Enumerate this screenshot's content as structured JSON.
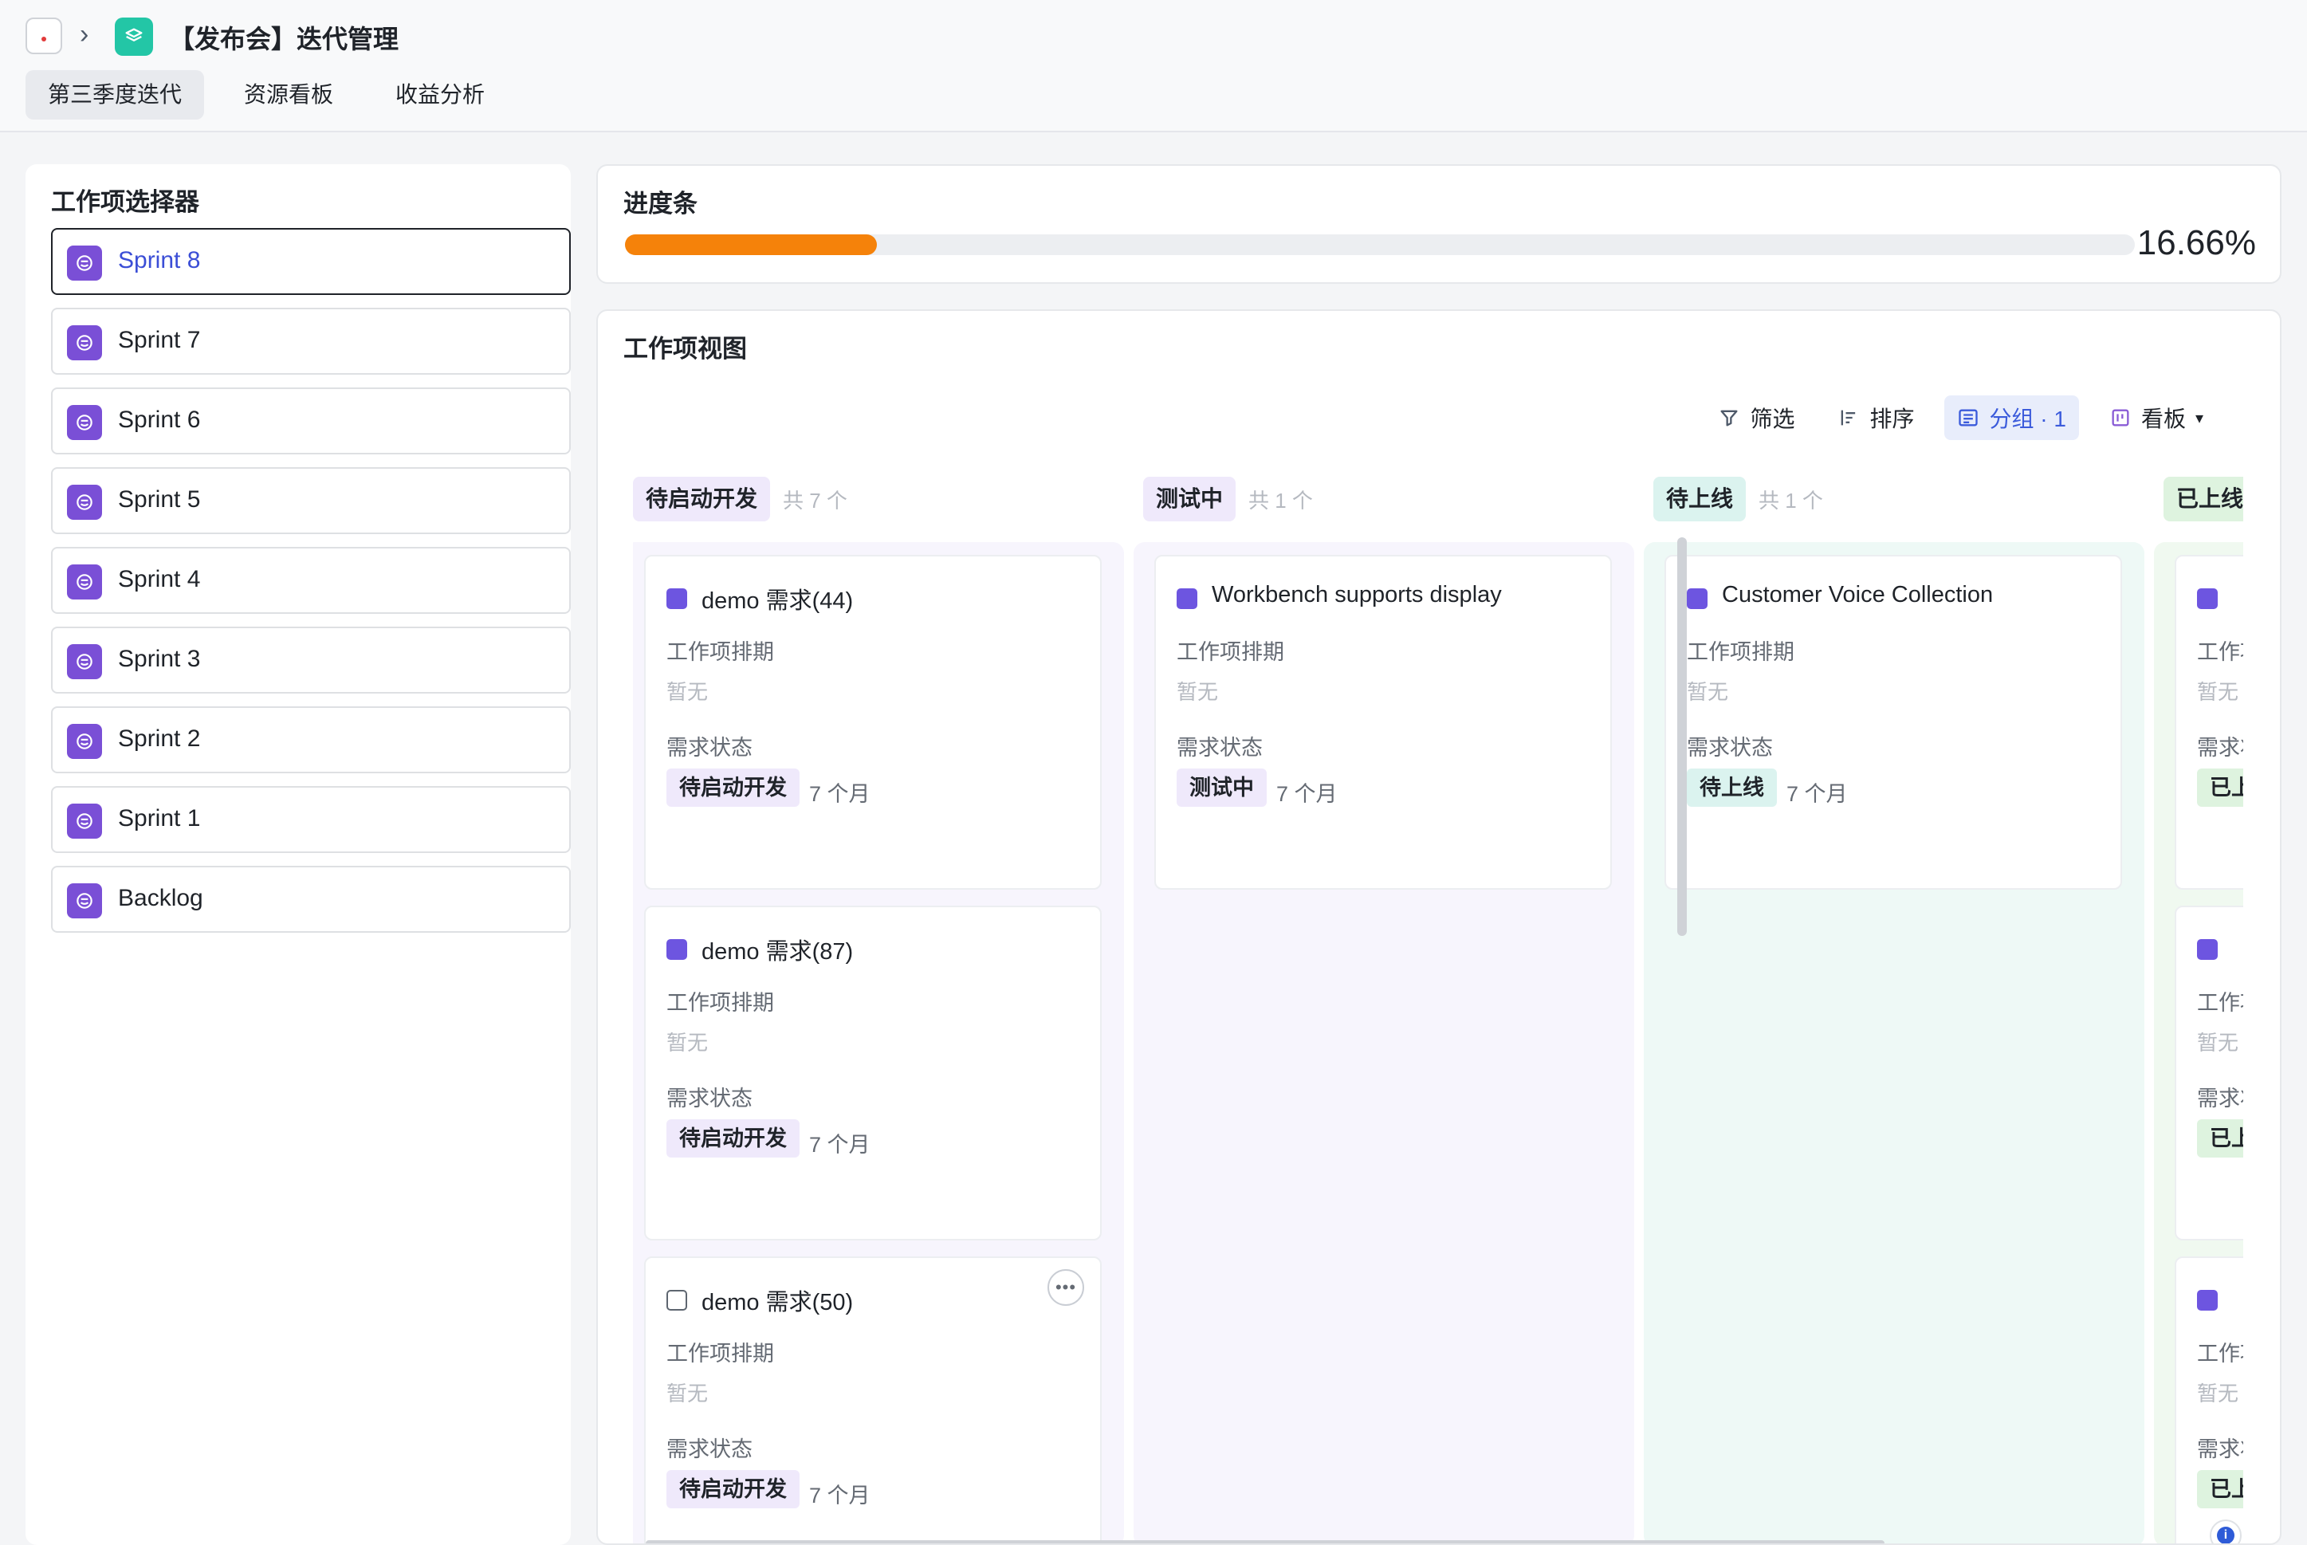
{
  "header": {
    "title": "【发布会】迭代管理",
    "tabs": [
      {
        "label": "第三季度迭代",
        "active": true
      },
      {
        "label": "资源看板",
        "active": false
      },
      {
        "label": "收益分析",
        "active": false
      }
    ]
  },
  "selector": {
    "title": "工作项选择器",
    "items": [
      {
        "label": "Sprint 8",
        "selected": true
      },
      {
        "label": "Sprint 7"
      },
      {
        "label": "Sprint 6"
      },
      {
        "label": "Sprint 5"
      },
      {
        "label": "Sprint 4"
      },
      {
        "label": "Sprint 3"
      },
      {
        "label": "Sprint 2"
      },
      {
        "label": "Sprint 1"
      },
      {
        "label": "Backlog"
      }
    ]
  },
  "progress": {
    "title": "进度条",
    "value_text": "16.66%",
    "fraction": 0.1666,
    "color": "#f5820a"
  },
  "workview": {
    "title": "工作项视图",
    "toolbar": {
      "filter": "筛选",
      "sort": "排序",
      "group": "分组 · 1",
      "view": "看板"
    },
    "columns": [
      {
        "tag": "待启动开发",
        "count": "共 7 个",
        "tag_bg": "#efe9fb",
        "body_bg": "#f7f5fd",
        "cards": [
          {
            "title": "demo 需求(44)",
            "label1": "工作项排期",
            "value1": "暂无",
            "label2": "需求状态",
            "status": "待启动开发",
            "time": "7 个月"
          },
          {
            "title": "demo 需求(87)",
            "label1": "工作项排期",
            "value1": "暂无",
            "label2": "需求状态",
            "status": "待启动开发",
            "time": "7 个月"
          },
          {
            "title": "demo 需求(50)",
            "label1": "工作项排期",
            "value1": "暂无",
            "label2": "需求状态",
            "status": "待启动开发",
            "time": "7 个月"
          }
        ]
      },
      {
        "tag": "测试中",
        "count": "共 1 个",
        "tag_bg": "#efe9fb",
        "body_bg": "#f7f5fd",
        "cards": [
          {
            "title": "Workbench supports display",
            "label1": "工作项排期",
            "value1": "暂无",
            "label2": "需求状态",
            "status": "测试中",
            "time": "7 个月"
          }
        ]
      },
      {
        "tag": "待上线",
        "count": "共 1 个",
        "tag_bg": "#dbf3ef",
        "body_bg": "#eef9f6",
        "cards": [
          {
            "title": "Customer Voice Collection",
            "label1": "工作项排期",
            "value1": "暂无",
            "label2": "需求状态",
            "status": "待上线",
            "time": "7 个月"
          }
        ]
      },
      {
        "tag": "已上线",
        "count": "",
        "tag_bg": "#def3df",
        "body_bg": "#f0f9f0",
        "cards": [
          {
            "title": "",
            "label1": "工作项排期",
            "value1": "暂无",
            "label2": "需求状态",
            "status": "已上线",
            "time": ""
          },
          {
            "title": "",
            "label1": "工作项排期",
            "value1": "暂无",
            "label2": "需求状态",
            "status": "已上线",
            "time": ""
          },
          {
            "title": "",
            "label1": "工作项排期",
            "value1": "暂无",
            "label2": "需求状态",
            "status": "已上线",
            "time": ""
          }
        ]
      }
    ]
  }
}
